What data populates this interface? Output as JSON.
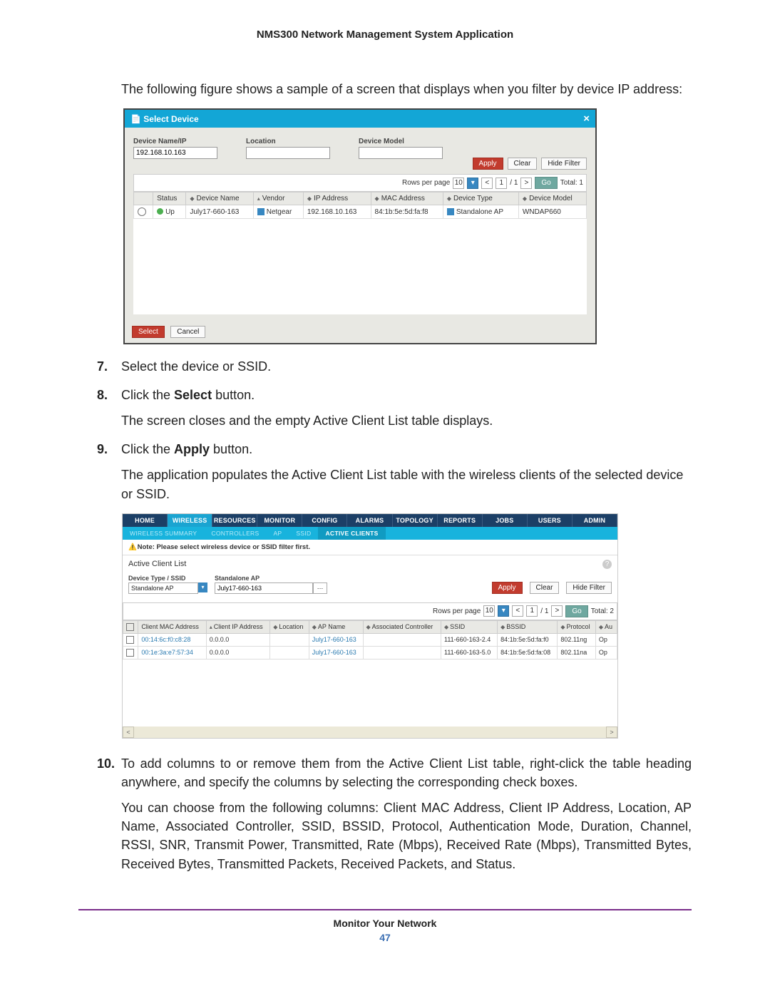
{
  "doc_header": "NMS300 Network Management System Application",
  "intro": "The following figure shows a sample of a screen that displays when you filter by device IP address:",
  "dlg": {
    "title": "Select Device",
    "fields": {
      "name_label": "Device Name/IP",
      "name_value": "192.168.10.163",
      "location_label": "Location",
      "model_label": "Device Model"
    },
    "buttons": {
      "apply": "Apply",
      "clear": "Clear",
      "hide": "Hide Filter",
      "select": "Select",
      "cancel": "Cancel"
    },
    "pager": {
      "label": "Rows per page",
      "size": "10",
      "page": "1",
      "total_pages": "/ 1",
      "go": "Go",
      "total": "Total: 1"
    },
    "headers": {
      "status": "Status",
      "name": "Device Name",
      "vendor": "Vendor",
      "ip": "IP Address",
      "mac": "MAC Address",
      "type": "Device Type",
      "model": "Device Model"
    },
    "row": {
      "status": "Up",
      "name": "July17-660-163",
      "vendor": "Netgear",
      "ip": "192.168.10.163",
      "mac": "84:1b:5e:5d:fa:f8",
      "type": "Standalone AP",
      "model": "WNDAP660"
    }
  },
  "step7": "Select the device or SSID.",
  "step8_a": "Click the ",
  "step8_b": "Select",
  "step8_c": " button.",
  "step8_sub": "The screen closes and the empty Active Client List table displays.",
  "step9_a": "Click the ",
  "step9_b": "Apply",
  "step9_c": " button.",
  "step9_sub": "The application populates the Active Client List table with the wireless clients of the selected device or SSID.",
  "app": {
    "tabs": [
      "HOME",
      "WIRELESS",
      "RESOURCES",
      "MONITOR",
      "CONFIG",
      "ALARMS",
      "TOPOLOGY",
      "REPORTS",
      "JOBS",
      "USERS",
      "ADMIN"
    ],
    "subtabs": [
      "WIRELESS SUMMARY",
      "CONTROLLERS",
      "AP",
      "SSID",
      "ACTIVE CLIENTS"
    ],
    "note": "Note: Please select wireless device or SSID filter first.",
    "section": "Active Client List",
    "filter": {
      "type_label": "Device Type / SSID",
      "type_value": "Standalone AP",
      "ap_label": "Standalone AP",
      "ap_value": "July17-660-163",
      "apply": "Apply",
      "clear": "Clear",
      "hide": "Hide Filter"
    },
    "pager": {
      "label": "Rows per page",
      "size": "10",
      "page": "1",
      "total_pages": "/ 1",
      "go": "Go",
      "total": "Total: 2"
    },
    "headers": {
      "mac": "Client MAC Address",
      "ip": "Client IP Address",
      "loc": "Location",
      "ap": "AP Name",
      "ctrl": "Associated Controller",
      "ssid": "SSID",
      "bssid": "BSSID",
      "proto": "Protocol",
      "au": "Au"
    },
    "rows": [
      {
        "mac": "00:14:6c:f0:c8:28",
        "ip": "0.0.0.0",
        "ap": "July17-660-163",
        "ssid": "111-660-163-2.4",
        "bssid": "84:1b:5e:5d:fa:f0",
        "proto": "802.11ng",
        "au": "Op"
      },
      {
        "mac": "00:1e:3a:e7:57:34",
        "ip": "0.0.0.0",
        "ap": "July17-660-163",
        "ssid": "111-660-163-5.0",
        "bssid": "84:1b:5e:5d:fa:08",
        "proto": "802.11na",
        "au": "Op"
      }
    ]
  },
  "step10": "To add columns to or remove them from the Active Client List table, right-click the table heading anywhere, and specify the columns by selecting the corresponding check boxes.",
  "step10_sub": "You can choose from the following columns: Client MAC Address, Client IP Address, Location, AP Name, Associated Controller, SSID, BSSID, Protocol, Authentication Mode, Duration, Channel, RSSI, SNR, Transmit Power, Transmitted, Rate (Mbps), Received Rate (Mbps), Transmitted Bytes, Received Bytes, Transmitted Packets, Received Packets, and Status.",
  "footer_title": "Monitor Your Network",
  "page_number": "47"
}
